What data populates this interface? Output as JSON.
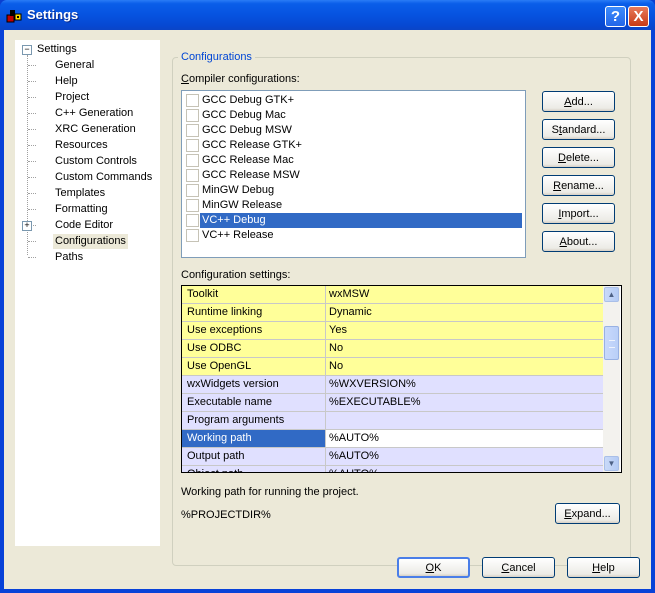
{
  "window": {
    "title": "Settings",
    "help_button": "?",
    "close_button": "X"
  },
  "tree": {
    "root": "Settings",
    "items": [
      {
        "label": "General"
      },
      {
        "label": "Help"
      },
      {
        "label": "Project"
      },
      {
        "label": "C++ Generation"
      },
      {
        "label": "XRC Generation"
      },
      {
        "label": "Resources"
      },
      {
        "label": "Custom Controls"
      },
      {
        "label": "Custom Commands"
      },
      {
        "label": "Templates"
      },
      {
        "label": "Formatting"
      },
      {
        "label": "Code Editor",
        "expandable": true
      },
      {
        "label": "Configurations",
        "selected": true
      },
      {
        "label": "Paths"
      }
    ]
  },
  "configurations": {
    "group_title": "Configurations",
    "compiler_label": "Compiler configurations:",
    "compilers": [
      {
        "label": "GCC Debug GTK+",
        "checked": false
      },
      {
        "label": "GCC Debug Mac",
        "checked": false
      },
      {
        "label": "GCC Debug MSW",
        "checked": false
      },
      {
        "label": "GCC Release GTK+",
        "checked": false
      },
      {
        "label": "GCC Release Mac",
        "checked": false
      },
      {
        "label": "GCC Release MSW",
        "checked": false
      },
      {
        "label": "MinGW Debug",
        "checked": false
      },
      {
        "label": "MinGW Release",
        "checked": false
      },
      {
        "label": "VC++ Debug",
        "checked": false,
        "selected": true
      },
      {
        "label": "VC++ Release",
        "checked": false
      }
    ],
    "buttons": {
      "add": "Add...",
      "standard": "Standard...",
      "delete": "Delete...",
      "rename": "Rename...",
      "import": "Import...",
      "about": "About..."
    },
    "settings_label": "Configuration settings:",
    "settings": [
      {
        "name": "Toolkit",
        "value": "wxMSW",
        "style": "yellow"
      },
      {
        "name": "Runtime linking",
        "value": "Dynamic",
        "style": "yellow"
      },
      {
        "name": "Use exceptions",
        "value": "Yes",
        "style": "yellow"
      },
      {
        "name": "Use ODBC",
        "value": "No",
        "style": "yellow"
      },
      {
        "name": "Use OpenGL",
        "value": "No",
        "style": "yellow"
      },
      {
        "name": "wxWidgets version",
        "value": "%WXVERSION%",
        "style": "lav"
      },
      {
        "name": "Executable name",
        "value": "%EXECUTABLE%",
        "style": "lav"
      },
      {
        "name": "Program arguments",
        "value": "",
        "style": "lav"
      },
      {
        "name": "Working path",
        "value": "%AUTO%",
        "style": "selrow"
      },
      {
        "name": "Output path",
        "value": "%AUTO%",
        "style": "lav"
      },
      {
        "name": "Object path",
        "value": "%AUTO%",
        "style": "lav"
      }
    ],
    "description": "Working path for running the project.",
    "current_value": "%PROJECTDIR%",
    "expand_button": "Expand..."
  },
  "dialog_buttons": {
    "ok": "OK",
    "cancel": "Cancel",
    "help": "Help"
  }
}
